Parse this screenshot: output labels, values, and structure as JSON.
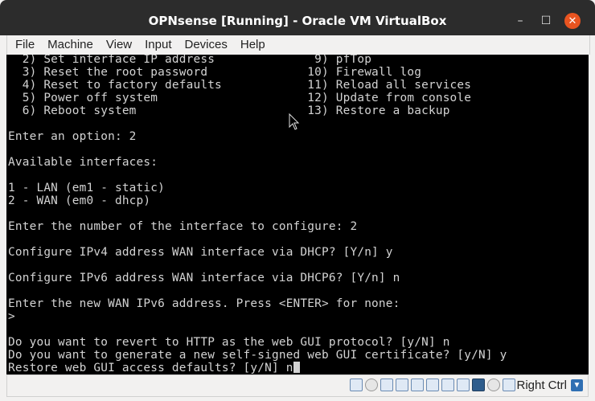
{
  "window": {
    "title": "OPNsense [Running] - Oracle VM VirtualBox",
    "minimize_glyph": "–",
    "maximize_glyph": "☐",
    "close_glyph": "✕"
  },
  "menubar": {
    "items": [
      "File",
      "Machine",
      "View",
      "Input",
      "Devices",
      "Help"
    ]
  },
  "console": {
    "lines": [
      "  2) Set interface IP address              9) pfTop",
      "  3) Reset the root password              10) Firewall log",
      "  4) Reset to factory defaults            11) Reload all services",
      "  5) Power off system                     12) Update from console",
      "  6) Reboot system                        13) Restore a backup",
      "",
      "Enter an option: 2",
      "",
      "Available interfaces:",
      "",
      "1 - LAN (em1 - static)",
      "2 - WAN (em0 - dhcp)",
      "",
      "Enter the number of the interface to configure: 2",
      "",
      "Configure IPv4 address WAN interface via DHCP? [Y/n] y",
      "",
      "Configure IPv6 address WAN interface via DHCP6? [Y/n] n",
      "",
      "Enter the new WAN IPv6 address. Press <ENTER> for none:",
      ">",
      "",
      "Do you want to revert to HTTP as the web GUI protocol? [y/N] n",
      "Do you want to generate a new self-signed web GUI certificate? [y/N] y",
      "Restore web GUI access defaults? [y/N] n"
    ]
  },
  "statusbar": {
    "host_key_label": "Right Ctrl",
    "icons": [
      "hard-disk-icon",
      "optical-drive-icon",
      "audio-icon",
      "network-icon",
      "usb-icon",
      "shared-folders-icon",
      "display-icon",
      "video-capture-icon",
      "recording-icon",
      "cpu-icon",
      "mouse-integration-icon",
      "keyboard-icon"
    ]
  }
}
